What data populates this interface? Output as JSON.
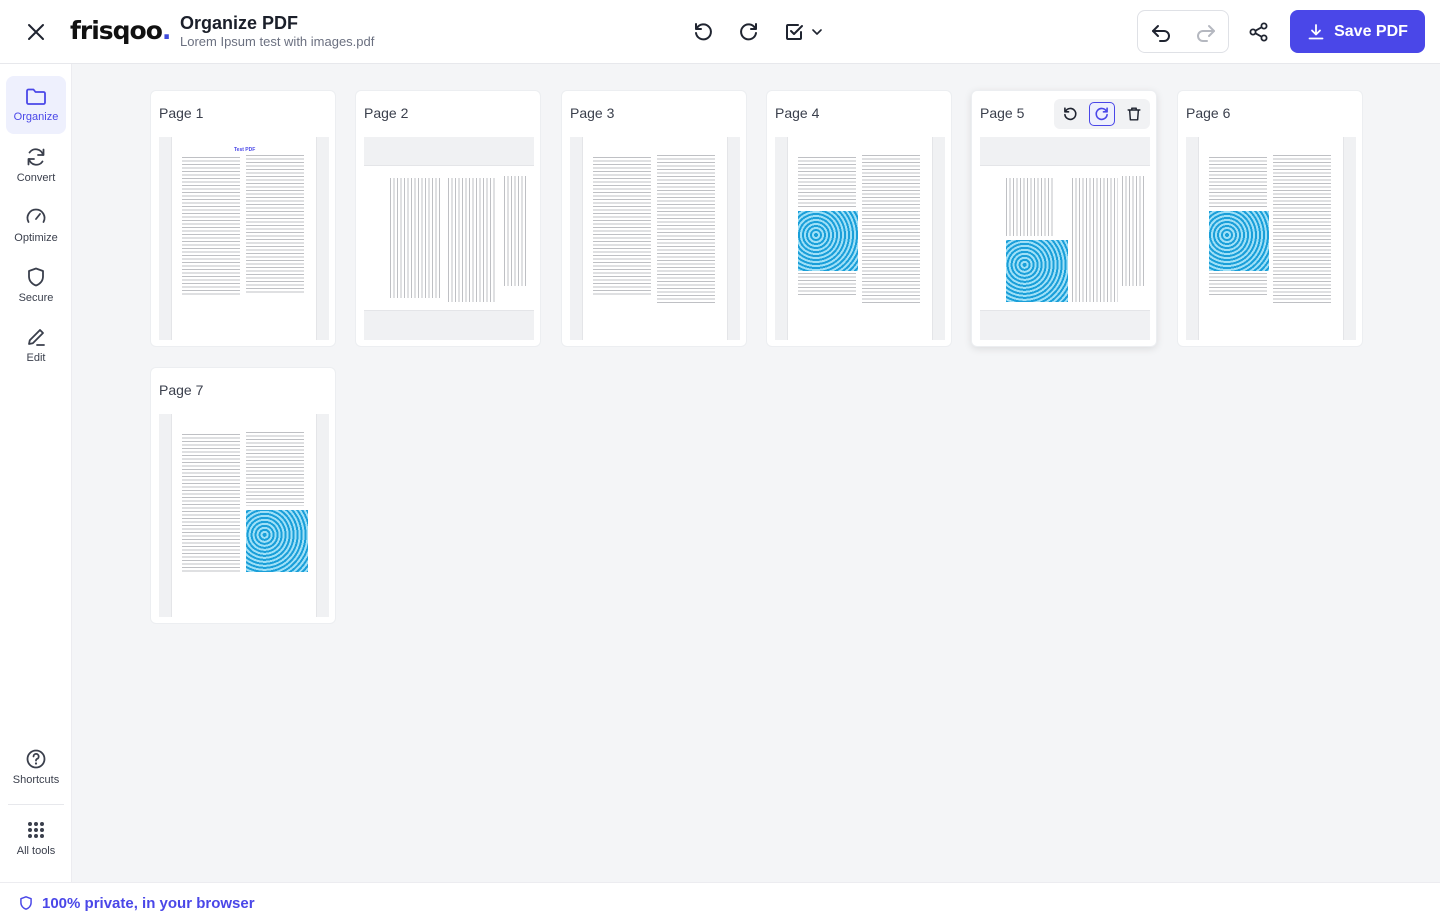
{
  "header": {
    "logo": {
      "text": "frisqoo",
      "dot": "."
    },
    "title": "Organize PDF",
    "file_name": "Lorem Ipsum test with images.pdf",
    "save_label": "Save PDF"
  },
  "sidebar": {
    "items": [
      {
        "label": "Organize",
        "icon": "folder-icon",
        "active": true
      },
      {
        "label": "Convert",
        "icon": "convert-icon"
      },
      {
        "label": "Optimize",
        "icon": "gauge-icon"
      },
      {
        "label": "Secure",
        "icon": "shield-icon"
      },
      {
        "label": "Edit",
        "icon": "pencil-icon"
      }
    ],
    "bottom": [
      {
        "label": "Shortcuts",
        "icon": "help-circle-icon"
      },
      {
        "label": "All tools",
        "icon": "grid-dots-icon"
      }
    ]
  },
  "pages": [
    {
      "label": "Page 1",
      "orientation": "portrait",
      "doc_title": "Test PDF"
    },
    {
      "label": "Page 2",
      "orientation": "landscape"
    },
    {
      "label": "Page 3",
      "orientation": "portrait"
    },
    {
      "label": "Page 4",
      "orientation": "portrait",
      "has_image": true
    },
    {
      "label": "Page 5",
      "orientation": "landscape",
      "has_image": true,
      "hovered": true
    },
    {
      "label": "Page 6",
      "orientation": "portrait",
      "has_image": true
    },
    {
      "label": "Page 7",
      "orientation": "portrait",
      "has_image": true
    }
  ],
  "footer": {
    "text": "100% private, in your browser"
  },
  "colors": {
    "accent": "#4a47e8",
    "image_blue": "#1a9fd9"
  }
}
